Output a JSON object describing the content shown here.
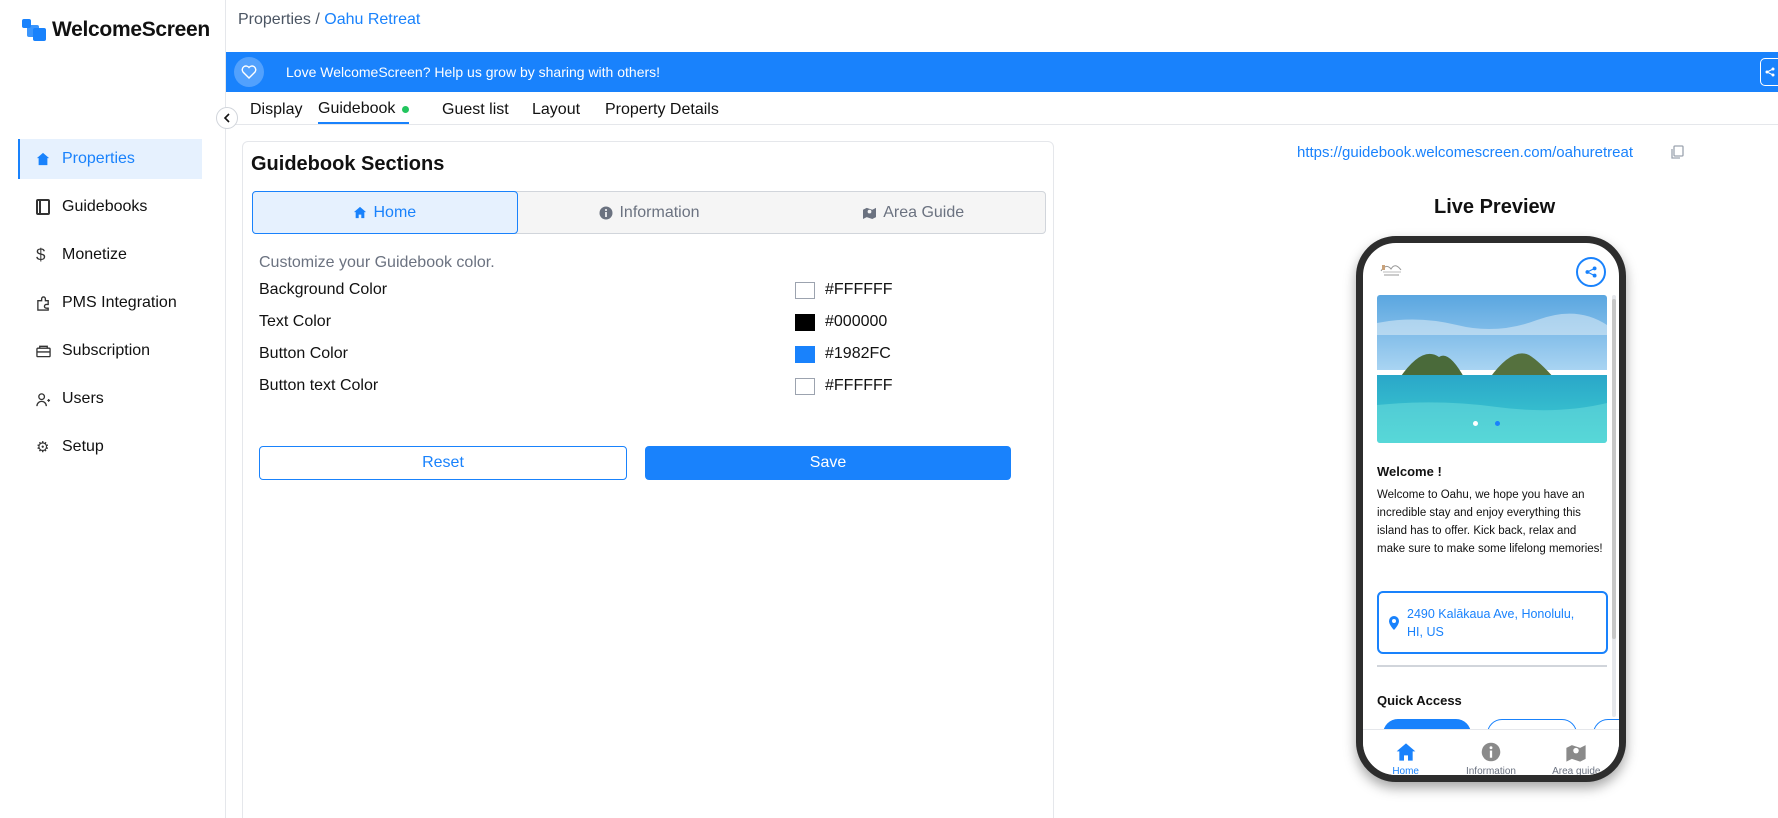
{
  "app": {
    "logo_text": "WelcomeScreen"
  },
  "sidebar": {
    "items": [
      {
        "label": "Properties",
        "icon": "home-icon",
        "active": true
      },
      {
        "label": "Guidebooks",
        "icon": "book-icon"
      },
      {
        "label": "Monetize",
        "icon": "dollar-icon"
      },
      {
        "label": "PMS Integration",
        "icon": "puzzle-icon"
      },
      {
        "label": "Subscription",
        "icon": "subscription-icon"
      },
      {
        "label": "Users",
        "icon": "users-icon"
      },
      {
        "label": "Setup",
        "icon": "gear-icon"
      }
    ]
  },
  "breadcrumb": {
    "root": "Properties",
    "separator": " / ",
    "current": "Oahu Retreat"
  },
  "banner": {
    "text": "Love WelcomeScreen? Help us grow by sharing with others!"
  },
  "tabs": [
    {
      "label": "Display"
    },
    {
      "label": "Guidebook",
      "active": true
    },
    {
      "label": "Guest list"
    },
    {
      "label": "Layout"
    },
    {
      "label": "Property Details"
    }
  ],
  "panel": {
    "title": "Guidebook Sections",
    "segments": [
      {
        "label": "Home",
        "icon": "home-icon",
        "active": true
      },
      {
        "label": "Information",
        "icon": "info-icon"
      },
      {
        "label": "Area Guide",
        "icon": "map-icon"
      }
    ],
    "hint": "Customize your Guidebook color.",
    "colors": [
      {
        "label": "Background Color",
        "value": "#FFFFFF"
      },
      {
        "label": "Text Color",
        "value": "#000000"
      },
      {
        "label": "Button Color",
        "value": "#1982FC"
      },
      {
        "label": "Button text Color",
        "value": "#FFFFFF"
      }
    ],
    "reset_label": "Reset",
    "save_label": "Save"
  },
  "preview": {
    "url": "https://guidebook.welcomescreen.com/oahuretreat",
    "title": "Live Preview",
    "welcome_title": "Welcome !",
    "welcome_body": "Welcome to Oahu, we hope you have an incredible stay and enjoy everything this island has to offer. Kick back, relax and make sure to make some lifelong memories!",
    "address": "2490 Kalākaua Ave, Honolulu, HI, US",
    "quick_access": "Quick Access",
    "nav": [
      {
        "label": "Home",
        "icon": "home-icon",
        "active": true
      },
      {
        "label": "Information",
        "icon": "info-icon"
      },
      {
        "label": "Area guide",
        "icon": "map-icon"
      }
    ]
  },
  "colors": {
    "accent": "#1982FC",
    "success": "#22c55e"
  }
}
